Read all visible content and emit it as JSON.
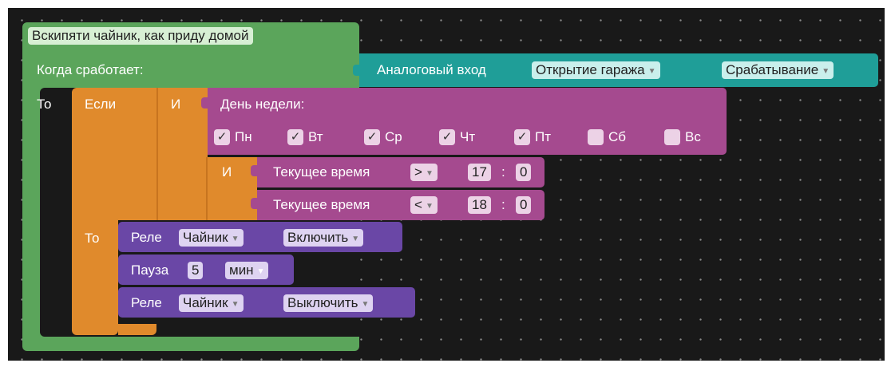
{
  "rule": {
    "title": "Вскипяти чайник, как приду домой",
    "when_label": "Когда сработает:",
    "then_label": "То"
  },
  "trigger": {
    "label": "Аналоговый вход",
    "input_value": "Открытие гаража",
    "event_value": "Срабатывание"
  },
  "if_block": {
    "if_label": "Если",
    "then_label": "То",
    "and_label_1": "И",
    "and_label_2": "И"
  },
  "weekday_block": {
    "label": "День недели:",
    "days": [
      {
        "label": "Пн",
        "checked": true,
        "mark": "✓"
      },
      {
        "label": "Вт",
        "checked": true,
        "mark": "✓"
      },
      {
        "label": "Ср",
        "checked": true,
        "mark": "✓"
      },
      {
        "label": "Чт",
        "checked": true,
        "mark": "✓"
      },
      {
        "label": "Пт",
        "checked": true,
        "mark": "✓"
      },
      {
        "label": "Сб",
        "checked": false,
        "mark": ""
      },
      {
        "label": "Вс",
        "checked": false,
        "mark": ""
      }
    ]
  },
  "time_conditions": [
    {
      "label": "Текущее время",
      "operator": ">",
      "hours": "17",
      "sep": ":",
      "minutes": "0"
    },
    {
      "label": "Текущее время",
      "operator": "<",
      "hours": "18",
      "sep": ":",
      "minutes": "0"
    }
  ],
  "actions": {
    "relay_on": {
      "label": "Реле",
      "device": "Чайник",
      "command": "Включить"
    },
    "pause": {
      "label": "Пауза",
      "value": "5",
      "unit": "мин"
    },
    "relay_off": {
      "label": "Реле",
      "device": "Чайник",
      "command": "Выключить"
    }
  },
  "colors": {
    "workspace": "#191919",
    "rule_block": "#5ba55b",
    "if_block": "#e08a2c",
    "condition_block": "#a54a8f",
    "action_block": "#6a47a6",
    "trigger_block": "#1f9e98"
  }
}
